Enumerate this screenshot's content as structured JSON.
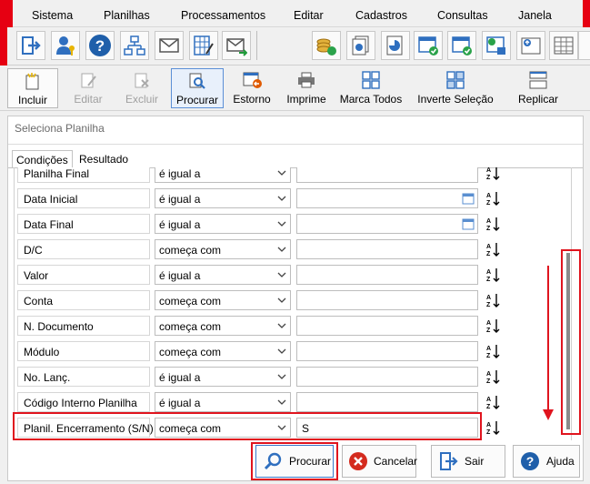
{
  "menu": [
    "Sistema",
    "Planilhas",
    "Processamentos",
    "Editar",
    "Cadastros",
    "Consultas",
    "Janela"
  ],
  "icon_toolbar": [
    "exit-icon",
    "user-key-icon",
    "help-icon",
    "org-chart-icon",
    "mail-icon",
    "spreadsheet-pen-icon",
    "mail-send-icon",
    "coins-refresh-icon",
    "documents-icon",
    "pie-report-icon",
    "calendar-check-icon",
    "calendar-list-icon",
    "money-calendar-icon",
    "upload-table-icon",
    "table-icon",
    "window-table-icon"
  ],
  "commands": [
    {
      "label": "Incluir",
      "enabled": true
    },
    {
      "label": "Editar",
      "enabled": false
    },
    {
      "label": "Excluir",
      "enabled": false
    },
    {
      "label": "Procurar",
      "enabled": true
    },
    {
      "label": "Estorno",
      "enabled": true
    },
    {
      "label": "Imprime",
      "enabled": true
    },
    {
      "label": "Marca Todos",
      "enabled": true
    },
    {
      "label": "Inverte Seleção",
      "enabled": true
    },
    {
      "label": "Replicar",
      "enabled": true
    }
  ],
  "panel": {
    "title": "Seleciona Planilha",
    "tabs": [
      "Condições",
      "Resultado"
    ]
  },
  "conditions": [
    {
      "field": "Planilha Final",
      "operator": "é igual a",
      "value": "",
      "has_calendar": false
    },
    {
      "field": "Data Inicial",
      "operator": "é igual a",
      "value": "",
      "has_calendar": true
    },
    {
      "field": "Data Final",
      "operator": "é igual a",
      "value": "",
      "has_calendar": true
    },
    {
      "field": "D/C",
      "operator": "começa com",
      "value": "",
      "has_calendar": false
    },
    {
      "field": "Valor",
      "operator": "é igual a",
      "value": "",
      "has_calendar": false
    },
    {
      "field": "Conta",
      "operator": "começa com",
      "value": "",
      "has_calendar": false
    },
    {
      "field": "N. Documento",
      "operator": "começa com",
      "value": "",
      "has_calendar": false
    },
    {
      "field": "Módulo",
      "operator": "começa com",
      "value": "",
      "has_calendar": false
    },
    {
      "field": "No. Lanç.",
      "operator": "é igual a",
      "value": "",
      "has_calendar": false
    },
    {
      "field": "Código Interno Planilha",
      "operator": "é igual a",
      "value": "",
      "has_calendar": false
    },
    {
      "field": "Planil. Encerramento (S/N)",
      "operator": "começa com",
      "value": "S",
      "has_calendar": false
    }
  ],
  "buttons": {
    "procurar": "Procurar",
    "cancelar": "Cancelar",
    "sair": "Sair",
    "ajuda": "Ajuda"
  },
  "colors": {
    "highlight": "#e0141e",
    "accent": "#2f6fbf"
  }
}
